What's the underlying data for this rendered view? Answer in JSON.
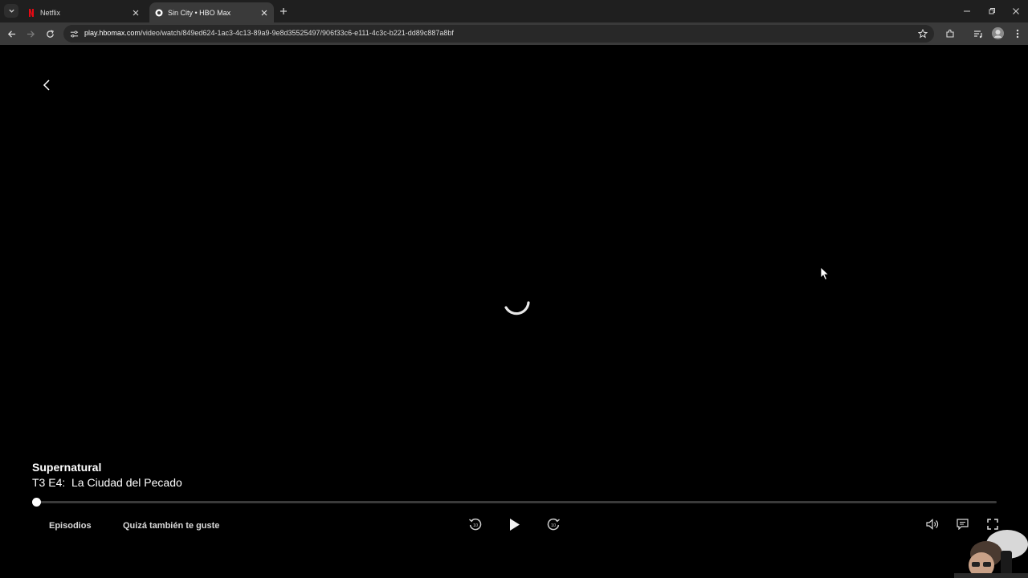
{
  "browser": {
    "tabs": [
      {
        "title": "Netflix",
        "active": false,
        "favicon": "netflix-favicon"
      },
      {
        "title": "Sin City • HBO Max",
        "active": true,
        "favicon": "hbomax-favicon"
      }
    ],
    "url_host": "play.hbomax.com",
    "url_path": "/video/watch/849ed624-1ac3-4c13-89a9-9e8d35525497/906f33c6-e111-4c3c-b221-dd89c887a8bf"
  },
  "player": {
    "show_title": "Supernatural",
    "episode_label": "T3 E4:  La Ciudad del Pecado",
    "progress": 0.0,
    "buttons": {
      "episodes": "Episodios",
      "you_may_like": "Quizá también te guste"
    },
    "icons": [
      "back-icon",
      "loading-spinner",
      "rewind-10-icon",
      "play-icon",
      "forward-10-icon",
      "volume-icon",
      "subtitles-icon",
      "fullscreen-icon"
    ]
  },
  "colors": {
    "accent": "#ffffff",
    "player_bg": "#000000",
    "netflix_red": "#e50914"
  }
}
